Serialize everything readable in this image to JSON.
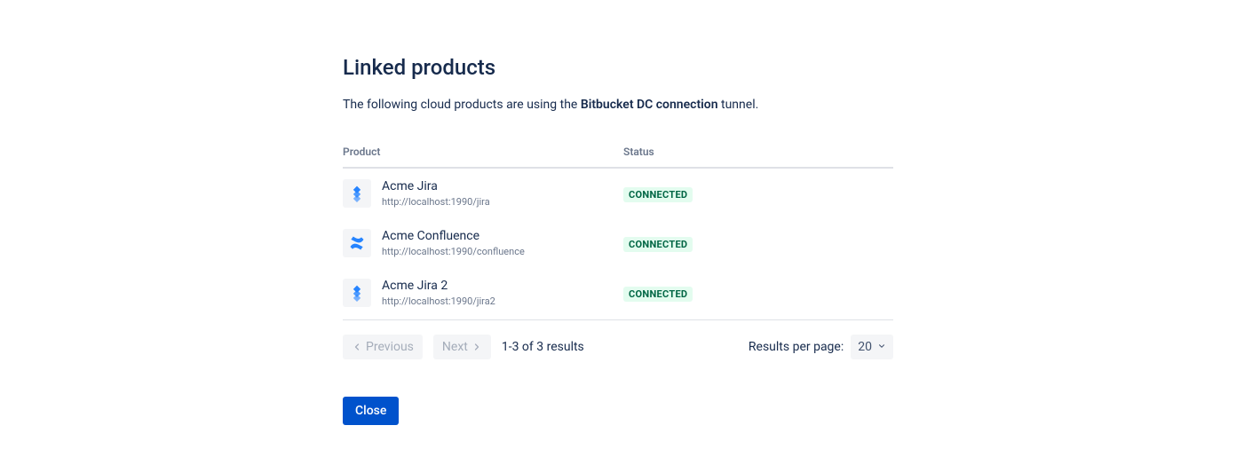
{
  "header": {
    "title": "Linked products",
    "description_prefix": "The following cloud products are using the ",
    "description_bold": "Bitbucket DC connection",
    "description_suffix": " tunnel."
  },
  "table": {
    "columns": {
      "product": "Product",
      "status": "Status"
    },
    "rows": [
      {
        "icon": "jira",
        "name": "Acme Jira",
        "url": "http://localhost:1990/jira",
        "status": "CONNECTED"
      },
      {
        "icon": "confluence",
        "name": "Acme Confluence",
        "url": "http://localhost:1990/confluence",
        "status": "CONNECTED"
      },
      {
        "icon": "jira",
        "name": "Acme Jira 2",
        "url": "http://localhost:1990/jira2",
        "status": "CONNECTED"
      }
    ]
  },
  "pagination": {
    "prev": "Previous",
    "next": "Next",
    "summary": "1-3 of 3 results",
    "rpp_label": "Results per page:",
    "rpp_value": "20"
  },
  "actions": {
    "close": "Close"
  }
}
